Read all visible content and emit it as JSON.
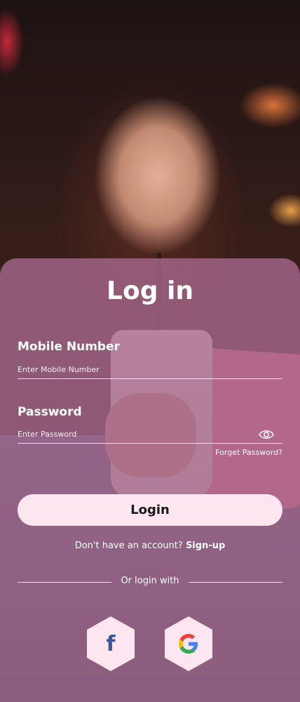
{
  "title": "Log in",
  "mobile": {
    "label": "Mobile Number",
    "placeholder": "Enter Mobile Number"
  },
  "password": {
    "label": "Password",
    "placeholder": "Enter Password",
    "forgot": "Forget Password?"
  },
  "login_button": "Login",
  "signup": {
    "prompt": "Don't have an account?",
    "link": "Sign-up"
  },
  "divider": "Or login with",
  "social": [
    {
      "name": "facebook",
      "glyph": "f",
      "icon": "facebook-icon"
    },
    {
      "name": "google",
      "icon": "google-icon"
    }
  ],
  "colors": {
    "panel": "#a6688c",
    "button": "#fde6f0",
    "facebook": "#3b5998",
    "hex_bg": "#fde6f0"
  }
}
